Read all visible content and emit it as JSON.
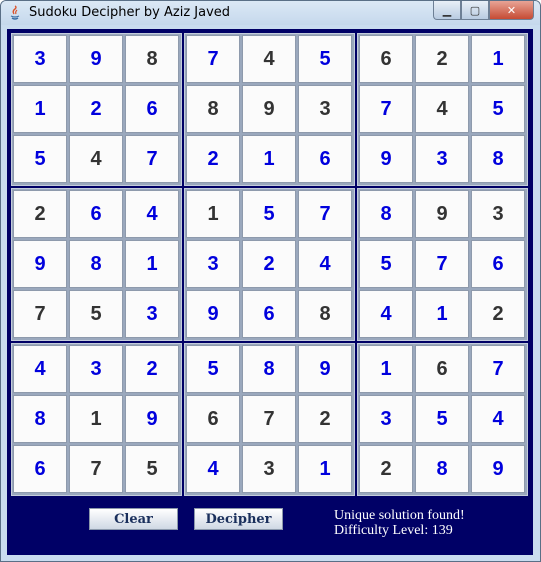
{
  "window": {
    "title": "Sudoku Decipher by Aziz Javed",
    "close_glyph": "✕",
    "minimize_glyph": "▁",
    "maximize_glyph": "▢"
  },
  "colors": {
    "client_background": "#000066",
    "solved_digit": "#0000dd",
    "given_digit": "#333333",
    "status_text": "#ffffff"
  },
  "board": [
    {
      "blocks": [
        {
          "cells": [
            {
              "v": "3",
              "given": false
            },
            {
              "v": "9",
              "given": false
            },
            {
              "v": "8",
              "given": true
            },
            {
              "v": "1",
              "given": false
            },
            {
              "v": "2",
              "given": false
            },
            {
              "v": "6",
              "given": false
            },
            {
              "v": "5",
              "given": false
            },
            {
              "v": "4",
              "given": true
            },
            {
              "v": "7",
              "given": false
            }
          ]
        },
        {
          "cells": [
            {
              "v": "7",
              "given": false
            },
            {
              "v": "4",
              "given": true
            },
            {
              "v": "5",
              "given": false
            },
            {
              "v": "8",
              "given": true
            },
            {
              "v": "9",
              "given": true
            },
            {
              "v": "3",
              "given": true
            },
            {
              "v": "2",
              "given": false
            },
            {
              "v": "1",
              "given": false
            },
            {
              "v": "6",
              "given": false
            }
          ]
        },
        {
          "cells": [
            {
              "v": "6",
              "given": true
            },
            {
              "v": "2",
              "given": true
            },
            {
              "v": "1",
              "given": false
            },
            {
              "v": "7",
              "given": false
            },
            {
              "v": "4",
              "given": true
            },
            {
              "v": "5",
              "given": false
            },
            {
              "v": "9",
              "given": false
            },
            {
              "v": "3",
              "given": false
            },
            {
              "v": "8",
              "given": false
            }
          ]
        }
      ]
    },
    {
      "blocks": [
        {
          "cells": [
            {
              "v": "2",
              "given": true
            },
            {
              "v": "6",
              "given": false
            },
            {
              "v": "4",
              "given": false
            },
            {
              "v": "9",
              "given": false
            },
            {
              "v": "8",
              "given": false
            },
            {
              "v": "1",
              "given": false
            },
            {
              "v": "7",
              "given": true
            },
            {
              "v": "5",
              "given": true
            },
            {
              "v": "3",
              "given": false
            }
          ]
        },
        {
          "cells": [
            {
              "v": "1",
              "given": true
            },
            {
              "v": "5",
              "given": false
            },
            {
              "v": "7",
              "given": false
            },
            {
              "v": "3",
              "given": false
            },
            {
              "v": "2",
              "given": false
            },
            {
              "v": "4",
              "given": false
            },
            {
              "v": "9",
              "given": false
            },
            {
              "v": "6",
              "given": false
            },
            {
              "v": "8",
              "given": true
            }
          ]
        },
        {
          "cells": [
            {
              "v": "8",
              "given": false
            },
            {
              "v": "9",
              "given": true
            },
            {
              "v": "3",
              "given": true
            },
            {
              "v": "5",
              "given": false
            },
            {
              "v": "7",
              "given": false
            },
            {
              "v": "6",
              "given": false
            },
            {
              "v": "4",
              "given": false
            },
            {
              "v": "1",
              "given": false
            },
            {
              "v": "2",
              "given": true
            }
          ]
        }
      ]
    },
    {
      "blocks": [
        {
          "cells": [
            {
              "v": "4",
              "given": false
            },
            {
              "v": "3",
              "given": false
            },
            {
              "v": "2",
              "given": false
            },
            {
              "v": "8",
              "given": false
            },
            {
              "v": "1",
              "given": true
            },
            {
              "v": "9",
              "given": false
            },
            {
              "v": "6",
              "given": false
            },
            {
              "v": "7",
              "given": true
            },
            {
              "v": "5",
              "given": true
            }
          ]
        },
        {
          "cells": [
            {
              "v": "5",
              "given": false
            },
            {
              "v": "8",
              "given": false
            },
            {
              "v": "9",
              "given": false
            },
            {
              "v": "6",
              "given": true
            },
            {
              "v": "7",
              "given": true
            },
            {
              "v": "2",
              "given": true
            },
            {
              "v": "4",
              "given": false
            },
            {
              "v": "3",
              "given": true
            },
            {
              "v": "1",
              "given": false
            }
          ]
        },
        {
          "cells": [
            {
              "v": "1",
              "given": false
            },
            {
              "v": "6",
              "given": true
            },
            {
              "v": "7",
              "given": false
            },
            {
              "v": "3",
              "given": false
            },
            {
              "v": "5",
              "given": false
            },
            {
              "v": "4",
              "given": false
            },
            {
              "v": "2",
              "given": true
            },
            {
              "v": "8",
              "given": false
            },
            {
              "v": "9",
              "given": false
            }
          ]
        }
      ]
    }
  ],
  "buttons": {
    "clear": "Clear",
    "decipher": "Decipher"
  },
  "status": {
    "line1": "Unique solution found!",
    "line2": "Difficulty Level: 139"
  }
}
